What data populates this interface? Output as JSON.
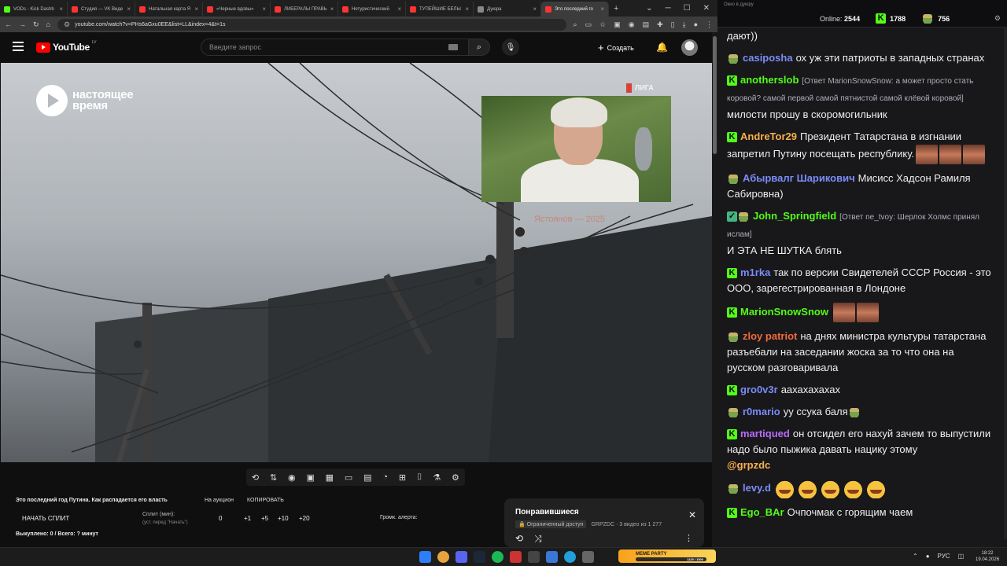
{
  "browser": {
    "tabs": [
      {
        "label": "VODs - Kick Dashb",
        "color": "#53fc18"
      },
      {
        "label": "Студия — VK Виде",
        "color": "#ff3333"
      },
      {
        "label": "Натальная карта Я",
        "color": "#ff3333"
      },
      {
        "label": "«Черные вдовы»",
        "color": "#ff3333"
      },
      {
        "label": "ЛИБЕРАЛЫ ПРАВЬ",
        "color": "#ff3333"
      },
      {
        "label": "Нетуристический",
        "color": "#ff3333"
      },
      {
        "label": "ТУПЕЙШИЕ БЕЛЫ",
        "color": "#ff3333"
      },
      {
        "label": "Дуюра",
        "color": "#888888"
      },
      {
        "label": "Это последний го",
        "color": "#ff3333"
      }
    ],
    "url": "youtube.com/watch?v=PHs6aGxu0EE&list=LL&index=4&t=1s"
  },
  "youtube": {
    "logo": "YouTube",
    "region": "LV",
    "search_placeholder": "Введите запрос",
    "create_label": "Создать"
  },
  "video": {
    "channel_logo_line1": "настоящее",
    "channel_logo_line2": "время",
    "corner_mark": "ЛИГА",
    "watermark": "Ястоянов — 2025"
  },
  "info": {
    "title": "Это последний год Путина. Как распадается его власть",
    "auction": "На аукцион",
    "copy": "КОПИРОВАТЬ",
    "start_split": "НАЧАТЬ СПЛИТ",
    "split_label": "Сплит (мин):",
    "split_sub": "(уст. перед \"Начать\")",
    "split_value": "0",
    "increments": [
      "+1",
      "+5",
      "+10",
      "+20"
    ],
    "alert_label": "Громк. алерта:",
    "sold": "Выкуплено: 0 / Всего: ? минут"
  },
  "playlist": {
    "title": "Понравившиеся",
    "access": "Ограниченный доступ",
    "meta": "GRPZDC · 3 видео из 1 277"
  },
  "chat": {
    "window_title": "Окно в дуюру",
    "online_label": "Online:",
    "online_value": "2544",
    "kick_count": "1788",
    "other_count": "756",
    "first_line": "дают))",
    "messages": [
      {
        "badge": "pepe",
        "nick": "casiposha",
        "color": "#7b8cf7",
        "reply": "",
        "text": "ох уж эти патриоты в западных странах"
      },
      {
        "badge": "kick",
        "nick": "anotherslob",
        "color": "#53fc18",
        "reply": "[Ответ MarionSnowSnow: а может просто стать коровой? самой первой самой пятнистой самой клёвой коровой]",
        "text": "милости прошу в скоромогильник"
      },
      {
        "badge": "kick",
        "nick": "AndreTor29",
        "color": "#f7b04c",
        "reply": "",
        "text": "Президент Татарстана в изгнании запретил Путину посещать республику."
      },
      {
        "badge": "pepe",
        "nick": "Абырвалг Шарикович",
        "color": "#7b8cf7",
        "reply": "",
        "text": "Мисисс Хадсон Рамиля Сабировна)"
      },
      {
        "badge": "pepe",
        "nick": "John_Springfield",
        "color": "#53fc18",
        "reply": "[Ответ ne_tvoy: Шерлок Холмс принял ислам]",
        "text": "И ЭТА НЕ ШУТКА блять"
      },
      {
        "badge": "kick",
        "nick": "m1rka",
        "color": "#7b8cf7",
        "reply": "",
        "text": "так по версии Свидетелей СССР Россия - это ООО, зарегестрированная в Лондоне"
      },
      {
        "badge": "kick",
        "nick": "MarionSnowSnow",
        "color": "#53fc18",
        "reply": "",
        "text": ""
      },
      {
        "badge": "pepe",
        "nick": "zloy patriot",
        "color": "#f26a3c",
        "reply": "",
        "text": "на днях министра культуры татарстана разъебали на заседании жоска за то что она на русском разговаривала"
      },
      {
        "badge": "kick",
        "nick": "gro0v3r",
        "color": "#7b8cf7",
        "reply": "",
        "text": "аахахахахах"
      },
      {
        "badge": "pepe",
        "nick": "r0mario",
        "color": "#7b8cf7",
        "reply": "",
        "text": "уу ссука баля"
      },
      {
        "badge": "kick",
        "nick": "martiqued",
        "color": "#b86cf7",
        "reply": "",
        "text": "он отсидел его нахуй зачем то выпустили надо было пыжика давать нацику этому",
        "mention": "@grpzdc"
      },
      {
        "badge": "pepe",
        "nick": "levy.d",
        "color": "#7b8cf7",
        "reply": "",
        "text": ""
      },
      {
        "badge": "kick",
        "nick": "Ego_BAr",
        "color": "#53fc18",
        "reply": "",
        "text": "Очпочмак с горящим чаем"
      }
    ]
  },
  "taskbar": {
    "meme_title": "MEME PARTY",
    "meme_progress": "1125 / 1500",
    "lang": "РУС",
    "time": "18:22",
    "date": "19.04.2026"
  }
}
